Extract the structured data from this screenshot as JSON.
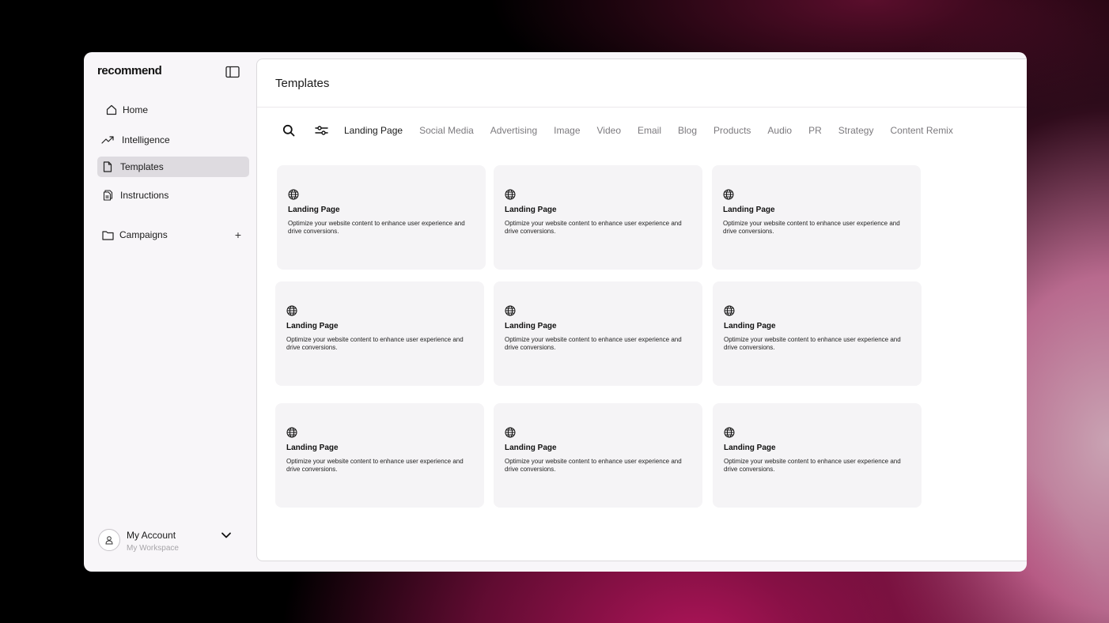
{
  "sidebar": {
    "logo": "recommend",
    "nav": {
      "home": "Home",
      "intelligence": "Intelligence",
      "templates": "Templates",
      "instructions": "Instructions",
      "campaigns": "Campaigns"
    },
    "add_campaign_icon": "+",
    "account": {
      "name": "My Account",
      "workspace": "My Workspace"
    }
  },
  "main": {
    "title": "Templates",
    "tabs": [
      {
        "label": "Landing Page",
        "active": true
      },
      {
        "label": "Social Media",
        "active": false
      },
      {
        "label": "Advertising",
        "active": false
      },
      {
        "label": "Image",
        "active": false
      },
      {
        "label": "Video",
        "active": false
      },
      {
        "label": "Email",
        "active": false
      },
      {
        "label": "Blog",
        "active": false
      },
      {
        "label": "Products",
        "active": false
      },
      {
        "label": "Audio",
        "active": false
      },
      {
        "label": "PR",
        "active": false
      },
      {
        "label": "Strategy",
        "active": false
      },
      {
        "label": "Content Remix",
        "active": false
      }
    ],
    "cards": [
      {
        "icon": "globe-icon",
        "title": "Landing Page",
        "description": "Optimize your website content to enhance user experience and drive conversions."
      },
      {
        "icon": "globe-icon",
        "title": "Landing Page",
        "description": "Optimize your website content to enhance user experience and drive conversions."
      },
      {
        "icon": "globe-icon",
        "title": "Landing Page",
        "description": "Optimize your website content to enhance user experience and drive conversions."
      },
      {
        "icon": "globe-icon",
        "title": "Landing Page",
        "description": "Optimize your website content to enhance user experience and drive conversions."
      },
      {
        "icon": "globe-icon",
        "title": "Landing Page",
        "description": "Optimize your website content to enhance user experience and drive conversions."
      },
      {
        "icon": "globe-icon",
        "title": "Landing Page",
        "description": "Optimize your website content to enhance user experience and drive conversions."
      },
      {
        "icon": "globe-icon",
        "title": "Landing Page",
        "description": "Optimize your website content to enhance user experience and drive conversions."
      },
      {
        "icon": "globe-icon",
        "title": "Landing Page",
        "description": "Optimize your website content to enhance user experience and drive conversions."
      },
      {
        "icon": "globe-icon",
        "title": "Landing Page",
        "description": "Optimize your website content to enhance user experience and drive conversions."
      }
    ]
  }
}
